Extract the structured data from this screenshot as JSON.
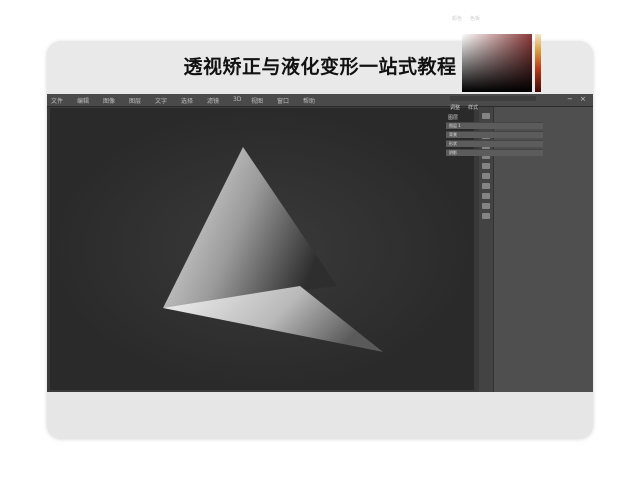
{
  "title": "透视矫正与液化变形一站式教程",
  "menubar": {
    "items": [
      "文件",
      "编辑",
      "图像",
      "图层",
      "文字",
      "选择",
      "滤镜",
      "3D",
      "视图",
      "窗口",
      "帮助"
    ],
    "window_controls": [
      "−",
      "×"
    ]
  },
  "panel": {
    "tabs": [
      "颜色",
      "色板"
    ],
    "sub_tabs": [
      "调整",
      "样式"
    ],
    "layers_header": "图层",
    "layers": [
      "图层 1",
      "背景",
      "形状",
      "阴影"
    ]
  },
  "icons": [
    "move-icon",
    "marquee-icon",
    "lasso-icon",
    "crop-icon",
    "brush-icon",
    "eraser-icon",
    "gradient-icon",
    "pen-icon",
    "text-icon",
    "hand-icon",
    "zoom-icon"
  ],
  "colors": {
    "canvas_bg": "#2a2a2a",
    "ui_bg": "#3a3a3a",
    "accent_hue": "#b93a16"
  }
}
